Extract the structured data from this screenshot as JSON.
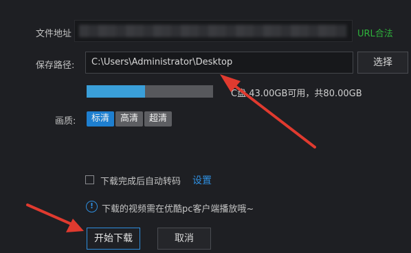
{
  "form": {
    "url_label": "文件地址",
    "url_status": "URL合法",
    "path_label": "保存路径:",
    "path_value": "C:\\Users\\Administrator\\Desktop",
    "choose_button": "选择",
    "disk_info": "C盘 43.00GB可用，共80.00GB",
    "disk_used_fraction": 0.46,
    "quality_label": "画质:",
    "quality_options": [
      "标清",
      "高清",
      "超清"
    ],
    "quality_selected": "标清",
    "autoconvert_label": "下载完成后自动转码",
    "autoconvert_checked": false,
    "settings_link": "设置",
    "notice": "下载的视频需在优酷pc客户端播放哦~",
    "start_button": "开始下载",
    "cancel_button": "取消"
  },
  "colors": {
    "accent": "#2f8fe0",
    "valid": "#2fb33c",
    "annotation_arrow": "#e03a2f"
  }
}
